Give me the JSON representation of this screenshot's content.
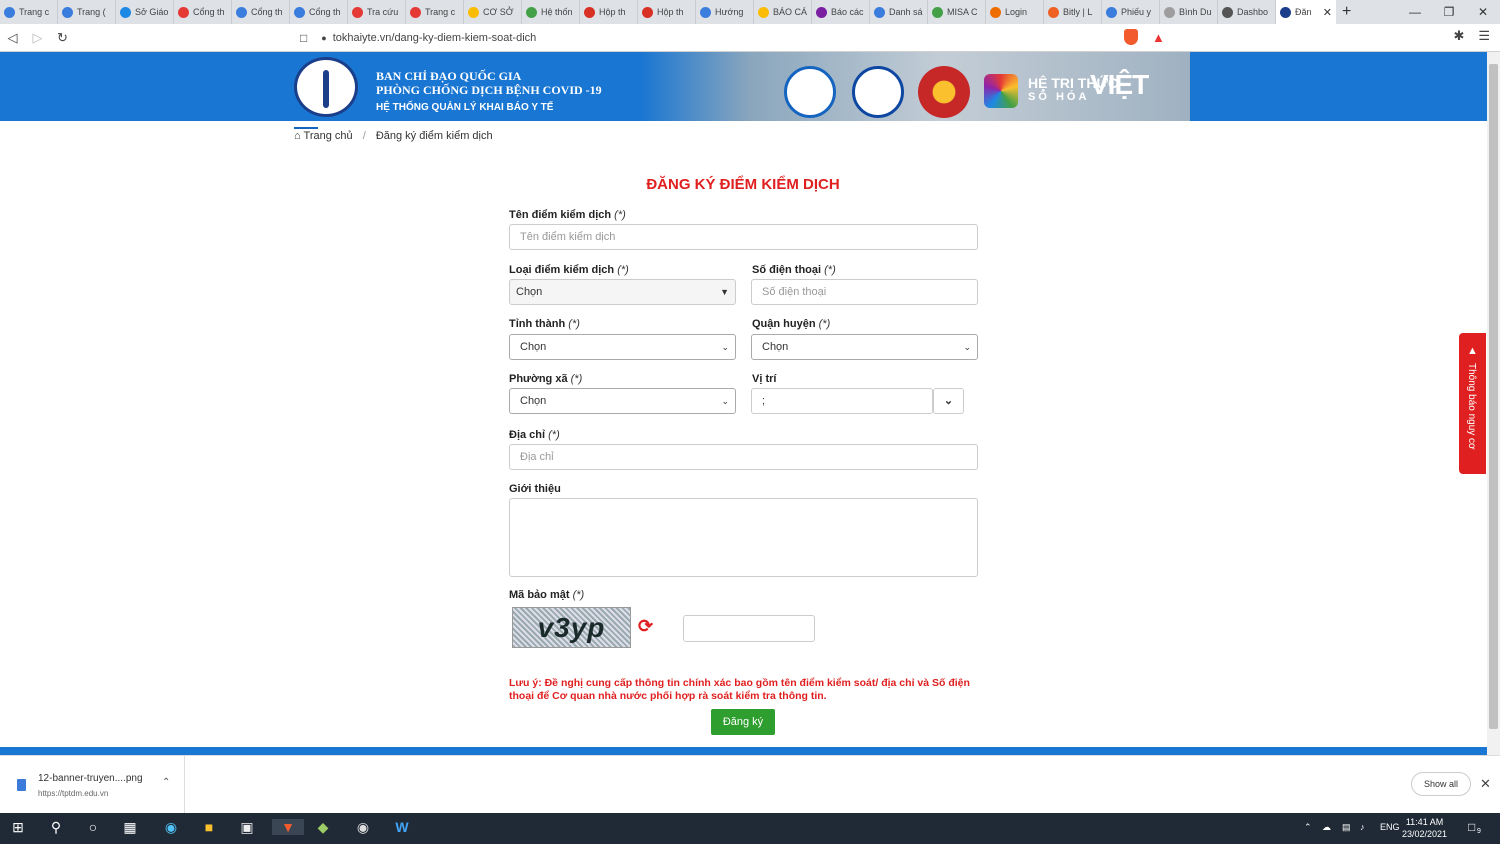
{
  "browser": {
    "tabs": [
      {
        "label": "Trang c",
        "color": "#3b7ddd"
      },
      {
        "label": "Trang (",
        "color": "#3b7ddd"
      },
      {
        "label": "Sở Giáo",
        "color": "#1e88e5"
      },
      {
        "label": "Cổng th",
        "color": "#e53935"
      },
      {
        "label": "Cổng th",
        "color": "#3b7ddd"
      },
      {
        "label": "Cổng th",
        "color": "#3b7ddd"
      },
      {
        "label": "Tra cứu",
        "color": "#e53935"
      },
      {
        "label": "Trang c",
        "color": "#e53935"
      },
      {
        "label": "CƠ SỞ",
        "color": "#fbbc05"
      },
      {
        "label": "Hệ thốn",
        "color": "#43a047"
      },
      {
        "label": "Hộp th",
        "color": "#d93025"
      },
      {
        "label": "Hộp th",
        "color": "#d93025"
      },
      {
        "label": "Hướng",
        "color": "#3b7ddd"
      },
      {
        "label": "BÁO CÁ",
        "color": "#fbbc05"
      },
      {
        "label": "Báo các",
        "color": "#7b1fa2"
      },
      {
        "label": "Danh sá",
        "color": "#3b7ddd"
      },
      {
        "label": "MISA C",
        "color": "#43a047"
      },
      {
        "label": "Login",
        "color": "#ef6c00"
      },
      {
        "label": "Bitly | L",
        "color": "#ee6123"
      },
      {
        "label": "Phiếu y",
        "color": "#3b7ddd"
      },
      {
        "label": "Bình Du",
        "color": "#9e9e9e"
      },
      {
        "label": "Dashbo",
        "color": "#555555"
      }
    ],
    "active_tab": {
      "label": "Đăn",
      "color": "#1a3e8a"
    },
    "url": "tokhaiyte.vn/dang-ky-diem-kiem-soat-dich"
  },
  "banner": {
    "line1": "BAN CHỈ ĐẠO QUỐC GIA",
    "line2": "PHÒNG CHỐNG DỊCH BỆNH COVID -19",
    "line3": "HỆ THỐNG QUẢN LÝ KHAI BÁO Y TẾ",
    "brand_small": "HỆ TRI THỨC",
    "brand_sub": "SỐ HÓA",
    "brand_big": "VIỆT"
  },
  "breadcrumb": {
    "home": "Trang chủ",
    "current": "Đăng ký điểm kiểm dịch"
  },
  "form": {
    "title": "ĐĂNG KÝ ĐIỂM KIỂM DỊCH",
    "required_mark": "(*)",
    "name_label": "Tên điểm kiểm dịch",
    "name_placeholder": "Tên điểm kiểm dịch",
    "type_label": "Loại điểm kiểm dịch",
    "type_value": "Chọn",
    "phone_label": "Số điện thoại",
    "phone_placeholder": "Số điện thoại",
    "province_label": "Tỉnh thành",
    "province_value": "Chọn",
    "district_label": "Quận huyện",
    "district_value": "Chọn",
    "ward_label": "Phường xã",
    "ward_value": "Chọn",
    "location_label": "Vị trí",
    "location_value": ";",
    "address_label": "Địa chỉ",
    "address_placeholder": "Địa chỉ",
    "intro_label": "Giới thiệu",
    "captcha_label": "Mã bảo mật",
    "captcha_text": "v3yp",
    "note": "Lưu ý: Đề nghị cung cấp thông tin chính xác bao gồm tên điểm kiểm soát/ địa chỉ và Số điện thoại để Cơ quan nhà nước phối hợp rà soát kiểm tra thông tin.",
    "submit_label": "Đăng ký"
  },
  "side_tab": {
    "label": "Thông báo nguy cơ"
  },
  "download": {
    "filename": "12-banner-truyen....png",
    "source": "https://tptdm.edu.vn",
    "show_all": "Show all"
  },
  "taskbar": {
    "lang": "ENG",
    "time": "11:41 AM",
    "date": "23/02/2021",
    "notif_count": "9"
  }
}
